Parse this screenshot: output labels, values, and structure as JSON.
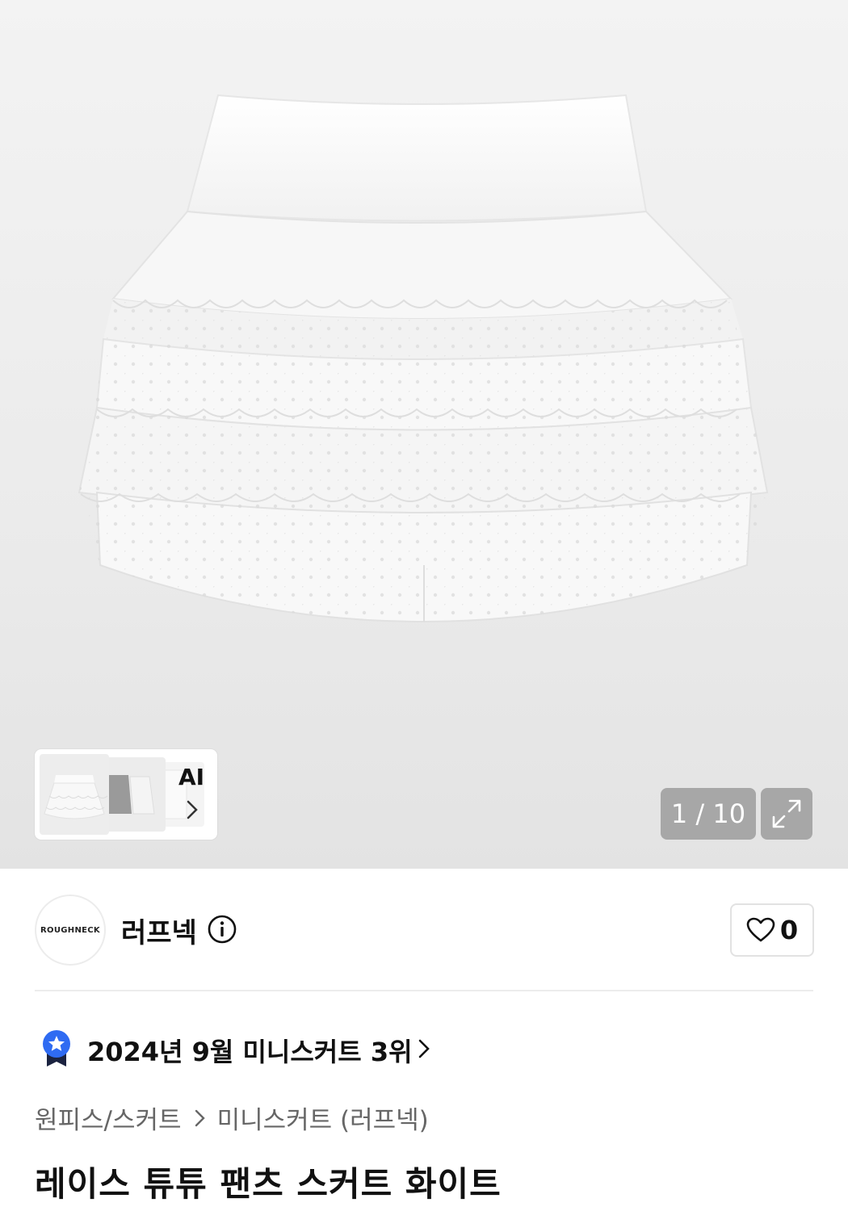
{
  "gallery": {
    "counter": "1 / 10",
    "ai_label": "AI"
  },
  "brand": {
    "logo_text": "ROUGHNECK",
    "name": "러프넥",
    "like_count": "0"
  },
  "ranking": {
    "text": "2024년 9월 미니스커트 3위"
  },
  "breadcrumb": {
    "category": "원피스/스커트",
    "subcategory": "미니스커트 (러프넥)"
  },
  "product": {
    "title": "레이스 튜튜 팬츠 스커트 화이트"
  },
  "colors": {
    "badge_blue": "#2f6bf2",
    "badge_navy": "#1b2340"
  }
}
